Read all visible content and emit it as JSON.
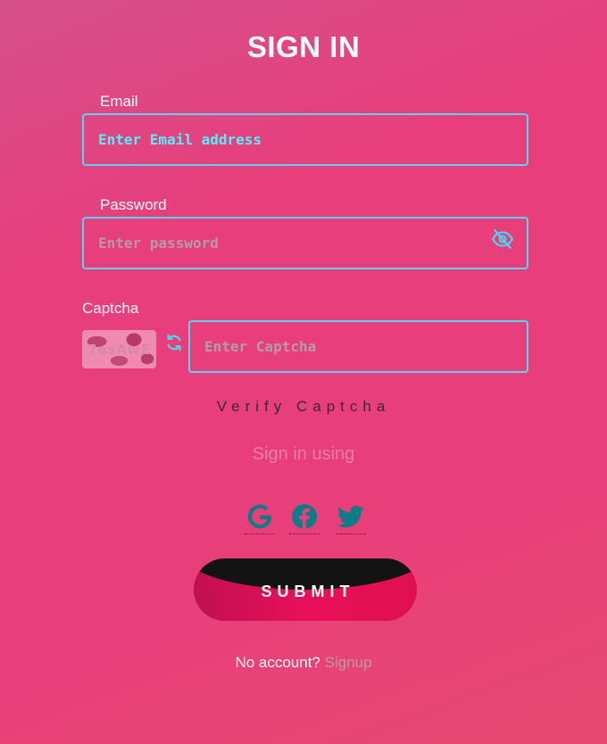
{
  "form": {
    "title": "SIGN IN",
    "email": {
      "label": "Email",
      "placeholder": "Enter Email address",
      "value": ""
    },
    "password": {
      "label": "Password",
      "placeholder": "Enter password",
      "value": ""
    },
    "captcha": {
      "label": "Captcha",
      "image_text": "7asAwE",
      "placeholder": "Enter Captcha",
      "value": ""
    },
    "verify_label": "Verify Captcha",
    "social_heading": "Sign in using",
    "social": [
      {
        "name": "google",
        "icon": "google-icon"
      },
      {
        "name": "facebook",
        "icon": "facebook-icon"
      },
      {
        "name": "twitter",
        "icon": "twitter-icon"
      }
    ],
    "submit_label": "SUBMIT",
    "footer": {
      "prompt": "No account?",
      "link": "Signup"
    }
  },
  "colors": {
    "background": "#e83e7c",
    "field_border": "#5ad3f0",
    "email_placeholder": "#4df2ff",
    "social_icon": "#0e7c86",
    "submit_fill": "#e8105a"
  }
}
